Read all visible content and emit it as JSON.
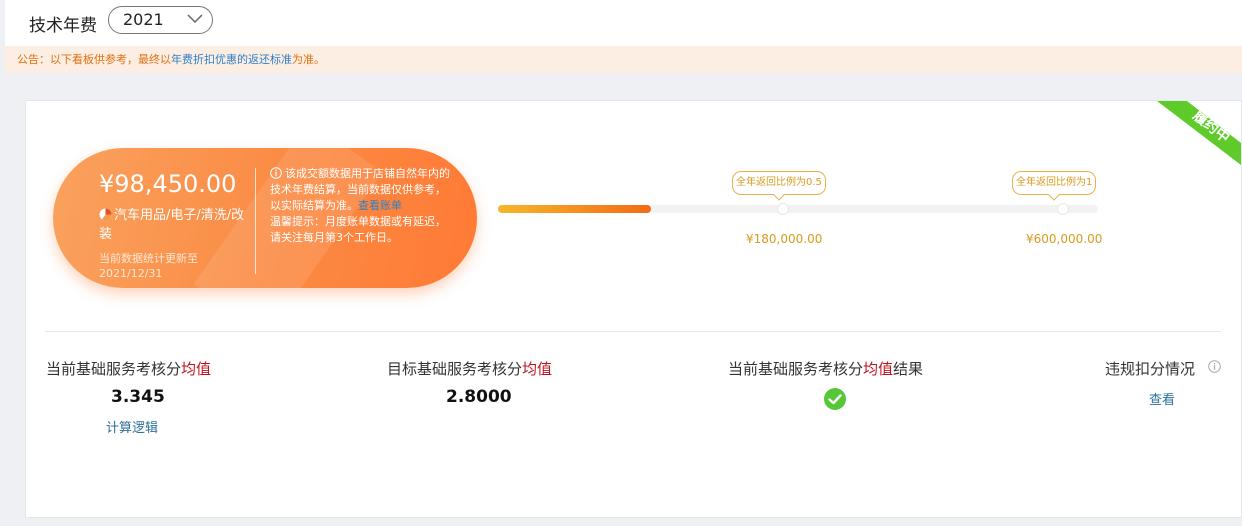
{
  "header": {
    "year_label": "技术年费",
    "year_value": "2021"
  },
  "notice": {
    "prefix": "公告：以下看板供参考，最终以",
    "link": "年费折扣优惠的返还标准",
    "suffix": "为准。"
  },
  "status_ribbon": "履约中",
  "summary": {
    "amount": "¥98,450.00",
    "category": "汽车用品/电子/清洗/改装",
    "update_label": "当前数据统计更新至",
    "update_date": "2021/12/31",
    "info_text": "该成交额数据用于店铺自然年内的技术年费结算，当前数据仅供参考，以实际结算为准。",
    "info_link": "查看账单",
    "tip_text": "温馨提示：月度账单数据或有延迟，请关注每月第3个工作日。"
  },
  "progress": {
    "fill_ratio": 0.255,
    "milestones": [
      {
        "tag": "全年返回比例为0.5",
        "amount": "¥180,000.00"
      },
      {
        "tag": "全年返回比例为1",
        "amount": "¥600,000.00"
      }
    ]
  },
  "stats": {
    "current": {
      "label": "当前基础服务考核分",
      "highlight": "均值",
      "value": "3.345",
      "link": "计算逻辑"
    },
    "target": {
      "label": "目标基础服务考核分",
      "highlight": "均值",
      "value": "2.8000"
    },
    "result": {
      "label": "当前基础服务考核分",
      "highlight": "均值",
      "suffix": "结果"
    },
    "violation": {
      "label": "违规扣分情况",
      "link": "查看"
    }
  },
  "colors": {
    "accent_orange": "#fb8a43",
    "ribbon_green": "#5ecb2a",
    "highlight_red": "#c0121e",
    "link_blue": "#2f80c8",
    "check_green": "#57c73a"
  },
  "icons": [
    "chevron-down-icon",
    "pie-chart-icon",
    "info-icon",
    "check-circle-icon",
    "question-icon"
  ]
}
